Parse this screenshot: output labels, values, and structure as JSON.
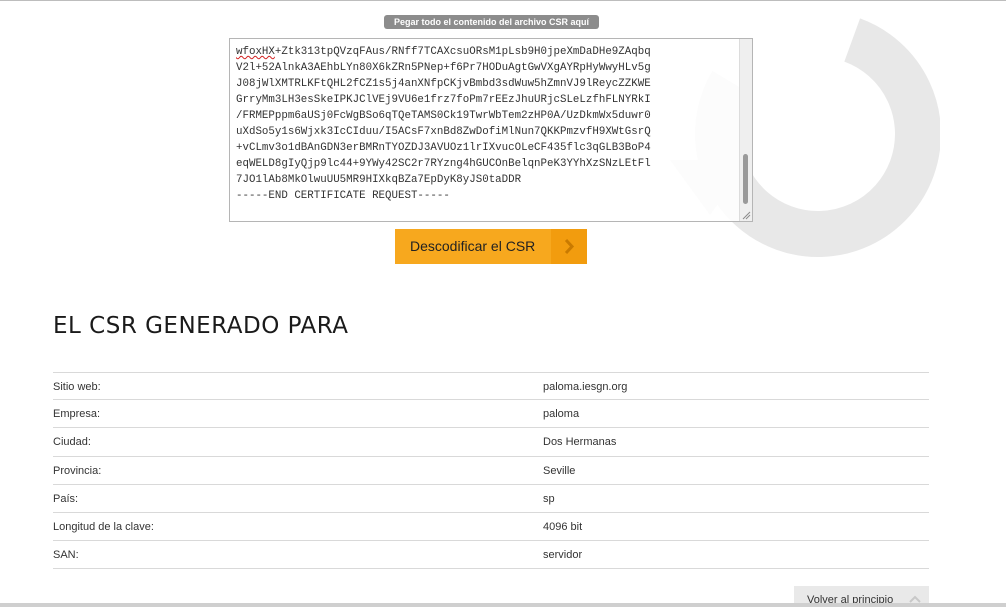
{
  "paste_label": "Pegar todo el contenido del archivo CSR aquí",
  "csr": {
    "lines": [
      "wfoxHX+Ztk313tpQVzqFAus/RNff7TCAXcsuORsM1pLsb9H0jpeXmDaDHe9ZAqbq",
      "V2l+52AlnkA3AEhbLYn80X6kZRn5PNep+f6Pr7HODuAgtGwVXgAYRpHyWwyHLv5g",
      "J08jWlXMTRLKFtQHL2fCZ1s5j4anXNfpCKjvBmbd3sdWuw5hZmnVJ9lReycZZKWE",
      "GrryMm3LH3esSkeIPKJClVEj9VU6e1frz7foPm7rEEzJhuURjcSLeLzfhFLNYRkI",
      "/FRMEPppm6aUSj0FcWgBSo6qTQeTAMS0Ck19TwrWbTem2zHP0A/UzDkmWx5duwr0",
      "uXdSo5y1s6Wjxk3IcCIduu/I5ACsF7xnBd8ZwDofiMlNun7QKKPmzvfH9XWtGsrQ",
      "+vCLmv3o1dBAnGDN3erBMRnTYOZDJ3AVUOz1lrIXvucOLeCF435flc3qGLB3BoP4",
      "eqWELD8gIyQjp9lc44+9YWy42SC2r7RYzng4hGUCOnBelqnPeK3YYhXzSNzLEtFl",
      "7JO1lAb8MkOlwuUU5MR9HIXkqBZa7EpDyK8yJS0taDDR",
      "-----END CERTIFICATE REQUEST-----"
    ],
    "first_token_marked": "wfoxHX"
  },
  "decode_button": "Descodificar el CSR",
  "section_title": "EL CSR GENERADO PARA",
  "details": [
    {
      "key": "Sitio web:",
      "value": "paloma.iesgn.org"
    },
    {
      "key": "Empresa:",
      "value": "paloma"
    },
    {
      "key": "Ciudad:",
      "value": "Dos Hermanas"
    },
    {
      "key": "Provincia:",
      "value": "Seville"
    },
    {
      "key": "País:",
      "value": "sp"
    },
    {
      "key": "Longitud de la clave:",
      "value": "4096 bit"
    },
    {
      "key": "SAN:",
      "value": "servidor"
    }
  ],
  "back_to_top": "Volver al principio",
  "icons": {
    "decode_arrow": "chevron-right-icon",
    "back_to_top": "chevron-up-icon",
    "background": "refresh-arc-icon"
  },
  "colors": {
    "accent": "#f7a81e",
    "label_bg": "#8c8c8c",
    "spellcheck": "#d21f1f"
  }
}
